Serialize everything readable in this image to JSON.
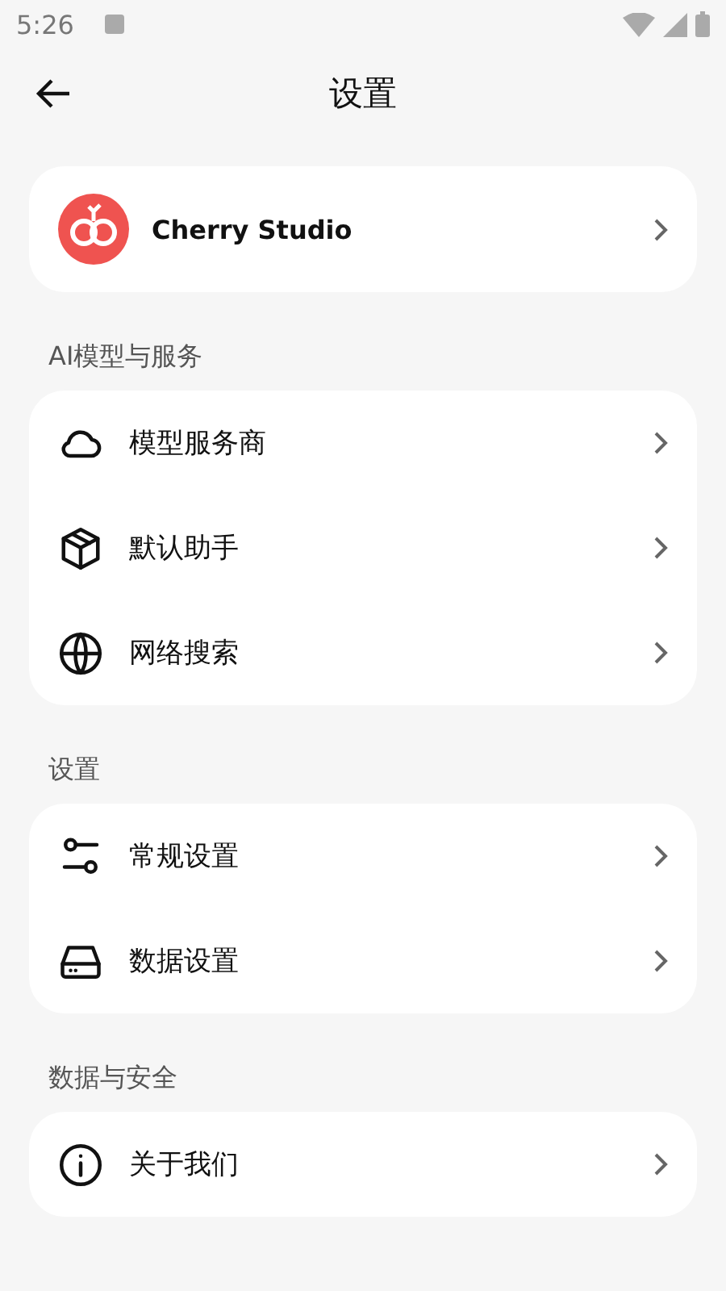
{
  "status_bar": {
    "time": "5:26"
  },
  "header": {
    "title": "设置"
  },
  "profile": {
    "name": "Cherry Studio"
  },
  "sections": [
    {
      "title": "AI模型与服务",
      "items": [
        {
          "label": "模型服务商"
        },
        {
          "label": "默认助手"
        },
        {
          "label": "网络搜索"
        }
      ]
    },
    {
      "title": "设置",
      "items": [
        {
          "label": "常规设置"
        },
        {
          "label": "数据设置"
        }
      ]
    },
    {
      "title": "数据与安全",
      "items": [
        {
          "label": "关于我们"
        }
      ]
    }
  ]
}
